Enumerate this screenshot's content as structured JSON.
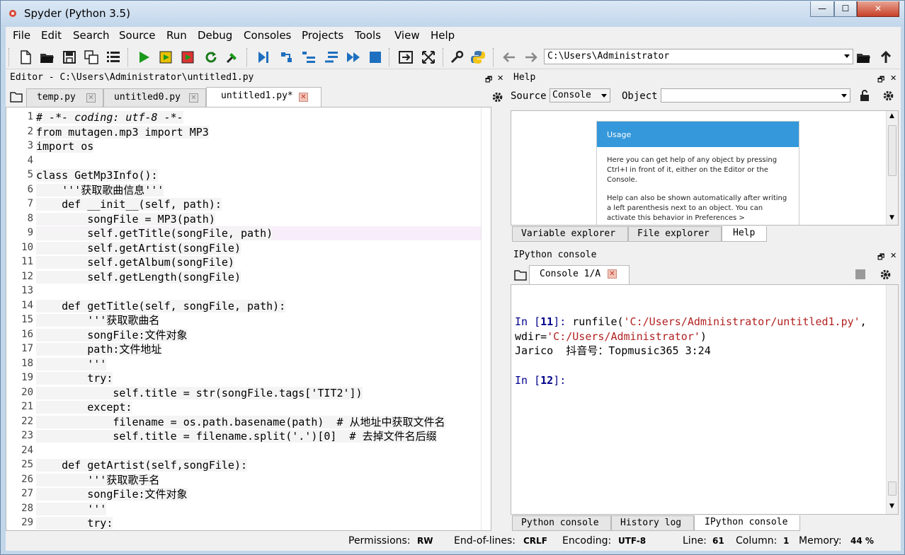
{
  "window": {
    "title": "Spyder (Python 3.5)",
    "min": "—",
    "max": "☐",
    "close": "✕"
  },
  "menu": [
    "File",
    "Edit",
    "Search",
    "Source",
    "Run",
    "Debug",
    "Consoles",
    "Projects",
    "Tools",
    "View",
    "Help"
  ],
  "toolbar": {
    "path": "C:\\Users\\Administrator"
  },
  "editor": {
    "header": "Editor - C:\\Users\\Administrator\\untitled1.py",
    "tabs": [
      {
        "label": "temp.py"
      },
      {
        "label": "untitled0.py"
      },
      {
        "label": "untitled1.py*"
      }
    ],
    "line_numbers": [
      "1",
      "2",
      "3",
      "4",
      "5",
      "6",
      "7",
      "8",
      "9",
      "10",
      "11",
      "12",
      "13",
      "14",
      "15",
      "16",
      "17",
      "18",
      "19",
      "20",
      "21",
      "22",
      "23",
      "24",
      "25",
      "26",
      "27",
      "28",
      "29"
    ],
    "lines": [
      "# -*- coding: utf-8 -*-",
      "from mutagen.mp3 import MP3",
      "import os",
      "",
      "class GetMp3Info():",
      "    '''获取歌曲信息'''",
      "    def __init__(self, path):",
      "        songFile = MP3(path)",
      "        self.getTitle(songFile, path)",
      "        self.getArtist(songFile)",
      "        self.getAlbum(songFile)",
      "        self.getLength(songFile)",
      "",
      "    def getTitle(self, songFile, path):",
      "        '''获取歌曲名",
      "        songFile:文件对象",
      "        path:文件地址",
      "        '''",
      "        try:",
      "            self.title = str(songFile.tags['TIT2'])",
      "        except:",
      "            filename = os.path.basename(path)  # 从地址中获取文件名",
      "            self.title = filename.split('.')[0]  # 去掉文件名后缀",
      "",
      "    def getArtist(self,songFile):",
      "        '''获取歌手名",
      "        songFile:文件对象",
      "        '''",
      "        try:"
    ]
  },
  "help": {
    "header": "Help",
    "source_label": "Source",
    "source_value": "Console",
    "object_label": "Object",
    "usage_title": "Usage",
    "usage_p1": "Here you can get help of any object by pressing Ctrl+I in front of it, either on the Editor or the Console.",
    "usage_p2": "Help can also be shown automatically after writing a left parenthesis next to an object. You can activate this behavior in Preferences >",
    "tabs": [
      "Variable explorer",
      "File explorer",
      "Help"
    ]
  },
  "ipython": {
    "header": "IPython console",
    "tab": "Console 1/A",
    "in11": "In [",
    "num11": "11",
    "close11": "]: ",
    "cmd1": "runfile(",
    "arg1": "'C:/Users/Administrator/untitled1.py'",
    "comma": ",",
    "wdir": "wdir=",
    "arg2": "'C:/Users/Administrator'",
    "paren": ")",
    "output": "Jarico  抖音号：Topmusic365 3:24",
    "in12": "In [",
    "num12": "12",
    "close12": "]:",
    "tabs": [
      "Python console",
      "History log",
      "IPython console"
    ]
  },
  "status": {
    "perm_label": "Permissions:",
    "perm_value": "RW",
    "eol_label": "End-of-lines:",
    "eol_value": "CRLF",
    "enc_label": "Encoding:",
    "enc_value": "UTF-8",
    "line_label": "Line:",
    "line_value": "61",
    "col_label": "Column:",
    "col_value": "1",
    "mem_label": "Memory:",
    "mem_value": "44 %"
  }
}
